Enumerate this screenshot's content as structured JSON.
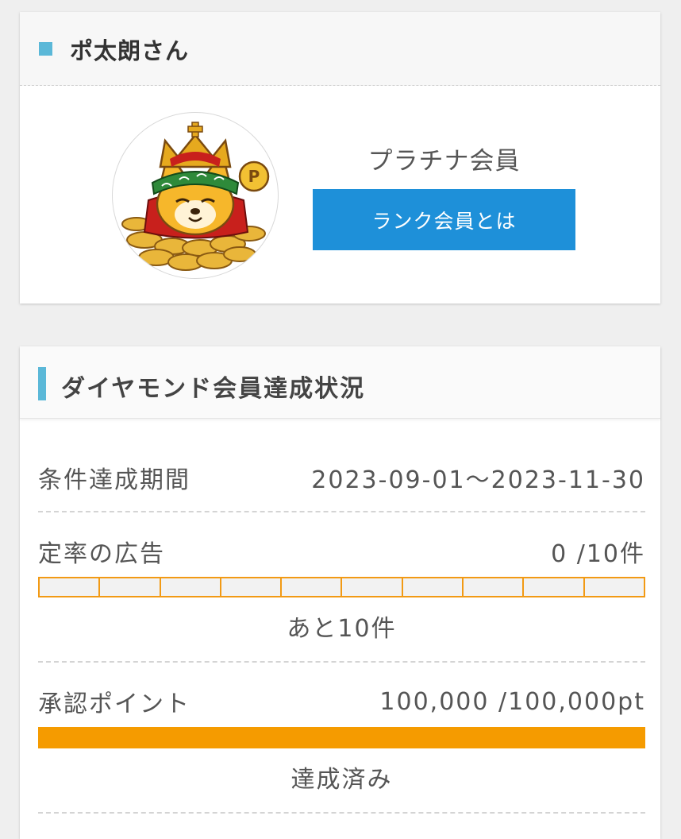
{
  "user": {
    "name": "ポ太朗さん",
    "rank": "プラチナ会員",
    "rank_button_label": "ランク会員とは"
  },
  "status": {
    "title": "ダイヤモンド会員達成状況",
    "period": {
      "label": "条件達成期間",
      "value": "2023-09-01～2023-11-30"
    },
    "ads": {
      "label": "定率の広告",
      "value": "0 /10件",
      "done": 0,
      "required": 10,
      "remaining_text": "あと10件"
    },
    "points": {
      "label": "承認ポイント",
      "value": "100,000 /100,000pt",
      "progress": 1.0,
      "status_text": "達成済み"
    }
  },
  "colors": {
    "accent_blue": "#1e90d9",
    "heading_marker": "#5bb8d8",
    "progress_orange": "#f59b00"
  }
}
